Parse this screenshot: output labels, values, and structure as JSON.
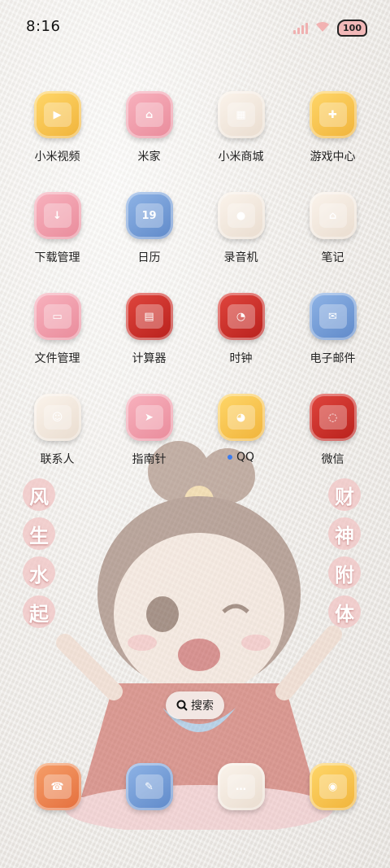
{
  "status_bar": {
    "time": "8:16",
    "battery": "100"
  },
  "apps": [
    {
      "id": "mi-video",
      "label": "小米视频",
      "color": "c-yellow",
      "icon": "video-camera-icon",
      "glyph": "▶"
    },
    {
      "id": "mi-home",
      "label": "米家",
      "color": "c-pink",
      "icon": "house-icon",
      "glyph": "⌂"
    },
    {
      "id": "mi-store",
      "label": "小米商城",
      "color": "c-cream",
      "icon": "store-icon",
      "glyph": "▦"
    },
    {
      "id": "game-center",
      "label": "游戏中心",
      "color": "c-yellow",
      "icon": "gamepad-icon",
      "glyph": "✚"
    },
    {
      "id": "downloads",
      "label": "下载管理",
      "color": "c-pink",
      "icon": "download-icon",
      "glyph": "↓"
    },
    {
      "id": "calendar",
      "label": "日历",
      "color": "c-blue",
      "icon": "calendar-icon",
      "glyph": "19"
    },
    {
      "id": "recorder",
      "label": "录音机",
      "color": "c-cream",
      "icon": "microphone-icon",
      "glyph": "●"
    },
    {
      "id": "notes",
      "label": "笔记",
      "color": "c-cream",
      "icon": "notes-icon",
      "glyph": "⌂"
    },
    {
      "id": "file-manager",
      "label": "文件管理",
      "color": "c-pink",
      "icon": "folder-icon",
      "glyph": "▭"
    },
    {
      "id": "calculator",
      "label": "计算器",
      "color": "c-red",
      "icon": "calculator-icon",
      "glyph": "▤"
    },
    {
      "id": "clock",
      "label": "时钟",
      "color": "c-red",
      "icon": "clock-icon",
      "glyph": "◔"
    },
    {
      "id": "email",
      "label": "电子邮件",
      "color": "c-blue",
      "icon": "mail-icon",
      "glyph": "✉"
    },
    {
      "id": "contacts",
      "label": "联系人",
      "color": "c-cream",
      "icon": "contacts-icon",
      "glyph": "☺"
    },
    {
      "id": "compass",
      "label": "指南针",
      "color": "c-pink",
      "icon": "compass-icon",
      "glyph": "➤"
    },
    {
      "id": "qq",
      "label": "QQ",
      "color": "c-yellow",
      "icon": "penguin-icon",
      "glyph": "◕",
      "new_dot": true
    },
    {
      "id": "wechat",
      "label": "微信",
      "color": "c-red",
      "icon": "chat-bubbles-icon",
      "glyph": "◌"
    }
  ],
  "side_left": [
    "风",
    "生",
    "水",
    "起"
  ],
  "side_right": [
    "财",
    "神",
    "附",
    "体"
  ],
  "search": {
    "label": "搜索",
    "icon": "search-icon"
  },
  "dock": [
    {
      "id": "phone",
      "color": "c-orange",
      "icon": "telephone-icon",
      "glyph": "☎"
    },
    {
      "id": "messages",
      "color": "c-blue",
      "icon": "message-icon",
      "glyph": "✎"
    },
    {
      "id": "browser",
      "color": "c-cream",
      "icon": "chat-icon",
      "glyph": "…"
    },
    {
      "id": "camera",
      "color": "c-yellow",
      "icon": "camera-icon",
      "glyph": "◉"
    }
  ]
}
